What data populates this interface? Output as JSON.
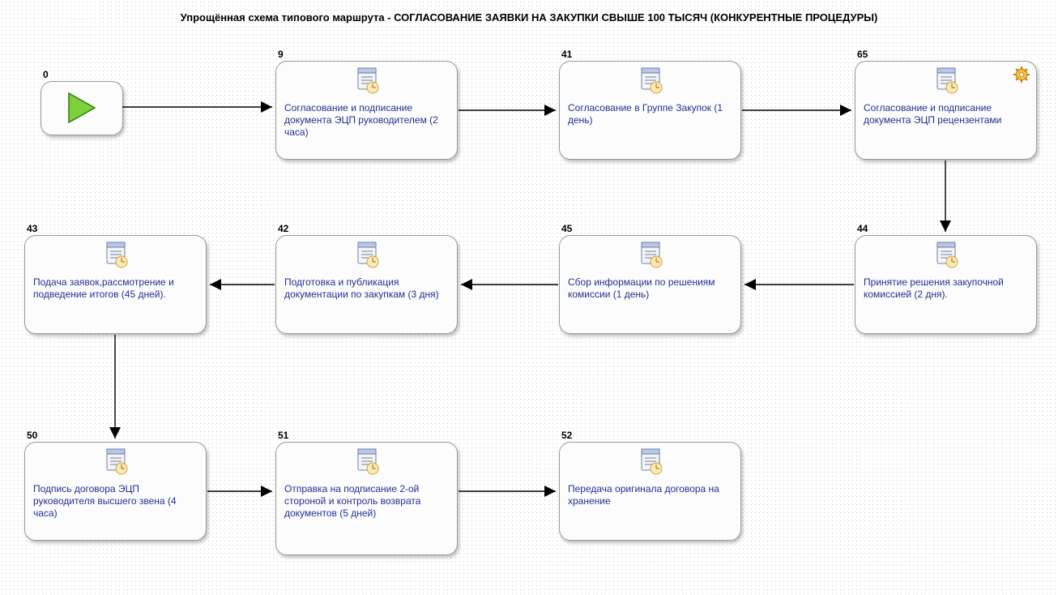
{
  "title": "Упрощённая схема типового маршрута - СОГЛАСОВАНИЕ ЗАЯВКИ НА ЗАКУПКИ СВЫШЕ 100 ТЫСЯЧ (КОНКУРЕНТНЫЕ ПРОЦЕДУРЫ)",
  "start": {
    "id": "0"
  },
  "nodes": {
    "n9": {
      "id": "9",
      "text": "Согласование и подписание документа ЭЦП руководителем (2 часа)"
    },
    "n41": {
      "id": "41",
      "text": "Согласование в Группе Закупок (1 день)"
    },
    "n65": {
      "id": "65",
      "text": "Согласование и подписание документа ЭЦП рецензентами"
    },
    "n44": {
      "id": "44",
      "text": "Принятие решения закупочной комиссией (2 дня)."
    },
    "n45": {
      "id": "45",
      "text": "Сбор информации по решениям комиссии (1 день)"
    },
    "n42": {
      "id": "42",
      "text": "Подготовка и публикация документации по закупкам (3 дня)"
    },
    "n43": {
      "id": "43",
      "text": "Подача заявок,рассмотрение и подведение итогов (45 дней)."
    },
    "n50": {
      "id": "50",
      "text": "Подпись договора ЭЦП руководителя высшего звена (4 часа)"
    },
    "n51": {
      "id": "51",
      "text": "Отправка на подписание 2-ой стороной и контроль возврата документов (5 дней)"
    },
    "n52": {
      "id": "52",
      "text": "Передача оригинала договора на хранение"
    }
  },
  "edges": [
    [
      "start",
      "n9"
    ],
    [
      "n9",
      "n41"
    ],
    [
      "n41",
      "n65"
    ],
    [
      "n65",
      "n44"
    ],
    [
      "n44",
      "n45"
    ],
    [
      "n45",
      "n42"
    ],
    [
      "n42",
      "n43"
    ],
    [
      "n43",
      "n50"
    ],
    [
      "n50",
      "n51"
    ],
    [
      "n51",
      "n52"
    ]
  ]
}
